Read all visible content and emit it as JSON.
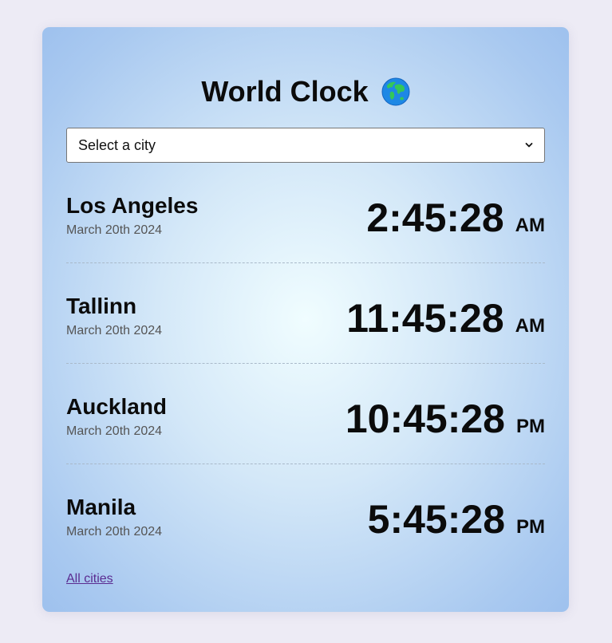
{
  "title": "World Clock",
  "icons": {
    "title_icon": "globe-icon",
    "select_icon": "chevron-down-icon"
  },
  "colors": {
    "card_gradient_center": "#f0fdff",
    "card_gradient_edge": "#9ec1ee",
    "page_background": "#edebf5",
    "link": "#5b2c91"
  },
  "select": {
    "value": "Select a city"
  },
  "cities": [
    {
      "name": "Los Angeles",
      "date": "March 20th 2024",
      "time": "2:45:28",
      "ampm": "AM"
    },
    {
      "name": "Tallinn",
      "date": "March 20th 2024",
      "time": "11:45:28",
      "ampm": "AM"
    },
    {
      "name": "Auckland",
      "date": "March 20th 2024",
      "time": "10:45:28",
      "ampm": "PM"
    },
    {
      "name": "Manila",
      "date": "March 20th 2024",
      "time": "5:45:28",
      "ampm": "PM"
    }
  ],
  "footer": {
    "link_label": "All cities"
  }
}
